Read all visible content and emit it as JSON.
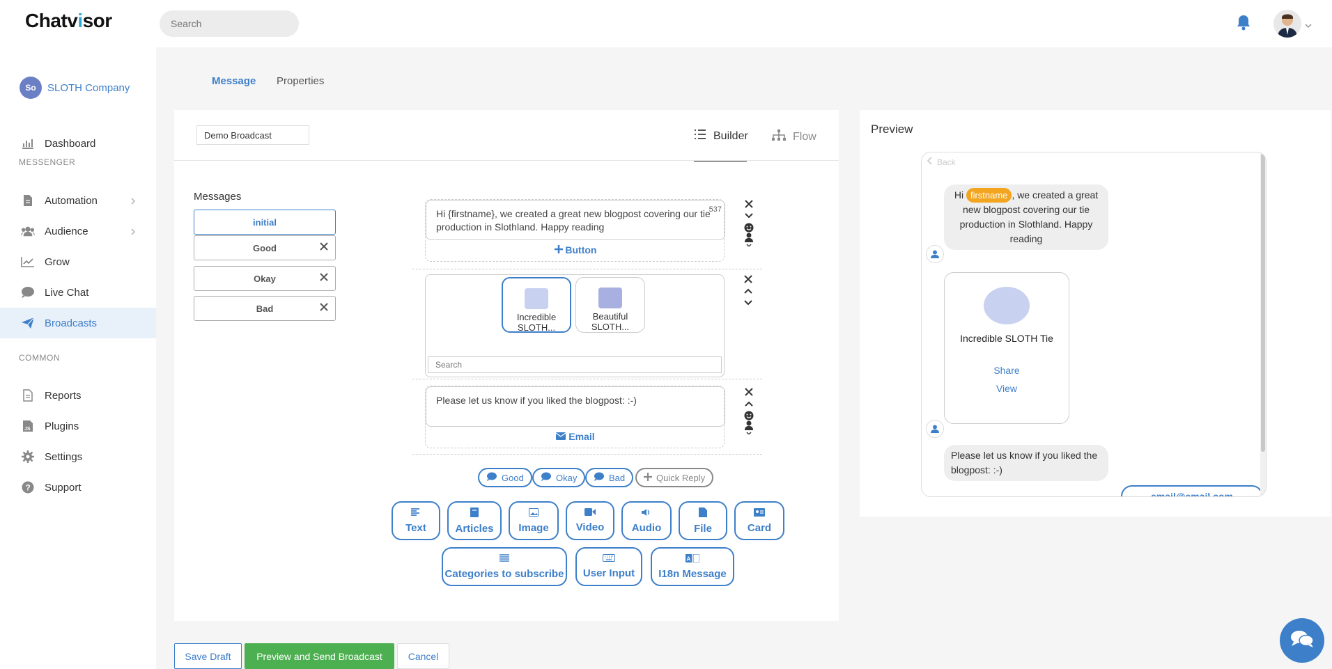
{
  "app": {
    "logo_prefix": "C",
    "logo_text": "hatv",
    "logo_accent": "i",
    "logo_suffix": "sor",
    "search_placeholder": "Search"
  },
  "sidebar": {
    "company": "SLOTH Company",
    "company_logo_text": "So",
    "sections": {
      "messenger": "MESSENGER",
      "common": "COMMON"
    },
    "items": [
      {
        "label": "Dashboard",
        "icon": "chart-bar-icon"
      },
      {
        "label": "Automation",
        "icon": "document-icon"
      },
      {
        "label": "Audience",
        "icon": "users-icon"
      },
      {
        "label": "Grow",
        "icon": "line-chart-icon"
      },
      {
        "label": "Live Chat",
        "icon": "chat-bubble-icon"
      },
      {
        "label": "Broadcasts",
        "icon": "paper-plane-icon"
      },
      {
        "label": "Reports",
        "icon": "report-icon"
      },
      {
        "label": "Plugins",
        "icon": "js-plugin-icon"
      },
      {
        "label": "Settings",
        "icon": "gear-icon"
      },
      {
        "label": "Support",
        "icon": "question-icon"
      }
    ]
  },
  "tabs": {
    "message": "Message",
    "properties": "Properties"
  },
  "builder": {
    "broadcast_name": "Demo Broadcast",
    "builder_tab": "Builder",
    "flow_tab": "Flow",
    "messages_label": "Messages",
    "messages": [
      {
        "label": "initial"
      },
      {
        "label": "Good"
      },
      {
        "label": "Okay"
      },
      {
        "label": "Bad"
      }
    ],
    "text1": "Hi {firstname}, we created a great new blogpost covering our tie production in Slothland. Happy reading",
    "text1_count": "537",
    "button_label": "Button",
    "articles": [
      {
        "title": "Incredible SLOTH..."
      },
      {
        "title": "Beautiful SLOTH..."
      }
    ],
    "article_search_placeholder": "Search",
    "text2": "Please let us know if you liked the blogpost: :-)",
    "email_label": "Email",
    "quick_replies": [
      "Good",
      "Okay",
      "Bad"
    ],
    "add_quick_reply": "Quick Reply",
    "tools_row1": [
      "Text",
      "Articles",
      "Image",
      "Video",
      "Audio",
      "File",
      "Card"
    ],
    "tools_row2": [
      "Categories to subscribe",
      "User Input",
      "I18n Message"
    ]
  },
  "actions": {
    "save_draft": "Save Draft",
    "send": "Preview and Send Broadcast",
    "cancel": "Cancel"
  },
  "preview": {
    "title": "Preview",
    "back": "Back",
    "msg1_before": "Hi ",
    "msg1_tag": "firstname",
    "msg1_after": ", we created a great new blogpost covering our tie production in Slothland. Happy reading",
    "card_title": "Incredible SLOTH Tie",
    "card_share": "Share",
    "card_view": "View",
    "msg2": "Please let us know if you liked the blogpost: :-)",
    "email_button": "email@email.com"
  },
  "colors": {
    "accent": "#3d7fc9",
    "success": "#4caf50",
    "tag": "#f3a520"
  }
}
